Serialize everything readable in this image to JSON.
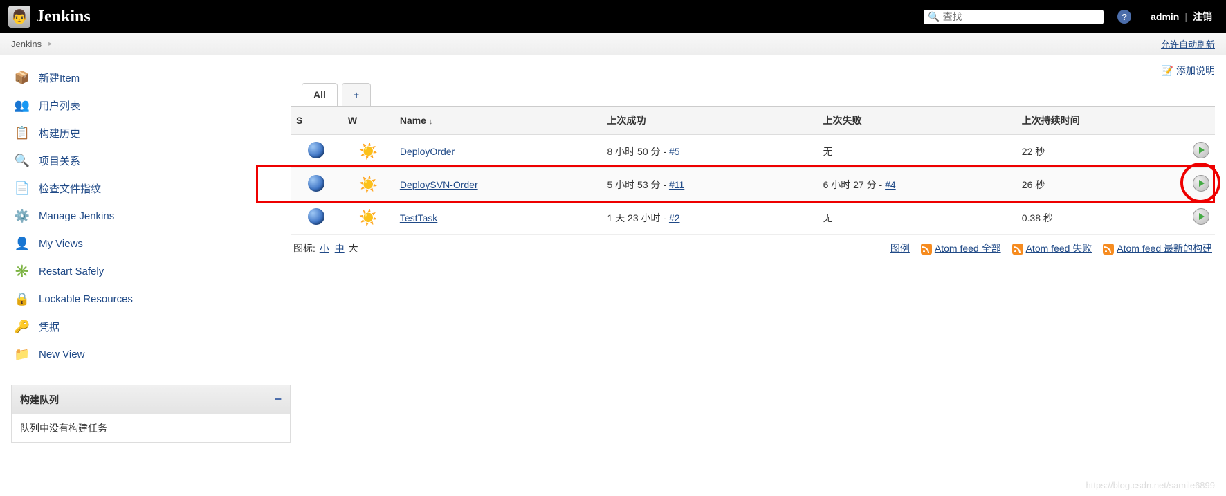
{
  "header": {
    "logo_text": "Jenkins",
    "search_placeholder": "查找",
    "user": "admin",
    "logout": "注销"
  },
  "breadcrumb": {
    "root": "Jenkins",
    "auto_refresh": "允许自动刷新"
  },
  "sidebar": {
    "items": [
      {
        "label": "新建Item",
        "icon": "📦"
      },
      {
        "label": "用户列表",
        "icon": "👥"
      },
      {
        "label": "构建历史",
        "icon": "📋"
      },
      {
        "label": "项目关系",
        "icon": "🔍"
      },
      {
        "label": "检查文件指纹",
        "icon": "📄"
      },
      {
        "label": "Manage Jenkins",
        "icon": "⚙️"
      },
      {
        "label": "My Views",
        "icon": "👤"
      },
      {
        "label": "Restart Safely",
        "icon": "✳️"
      },
      {
        "label": "Lockable Resources",
        "icon": "🔒"
      },
      {
        "label": "凭据",
        "icon": "🔑"
      },
      {
        "label": "New View",
        "icon": "📁"
      }
    ],
    "panel_title": "构建队列",
    "panel_body": "队列中没有构建任务"
  },
  "content": {
    "add_description": "添加说明",
    "tabs": {
      "all": "All",
      "add": "+"
    },
    "columns": {
      "s": "S",
      "w": "W",
      "name": "Name",
      "last_success": "上次成功",
      "last_failure": "上次失败",
      "duration": "上次持续时间"
    },
    "jobs": [
      {
        "name": "DeployOrder",
        "success_time": "8 小时 50 分",
        "success_build": "#5",
        "failure": "无",
        "duration": "22 秒"
      },
      {
        "name": "DeploySVN-Order",
        "success_time": "5 小时 53 分",
        "success_build": "#11",
        "failure_time": "6 小时 27 分",
        "failure_build": "#4",
        "duration": "26 秒"
      },
      {
        "name": "TestTask",
        "success_time": "1 天 23 小时",
        "success_build": "#2",
        "failure": "无",
        "duration": "0.38 秒"
      }
    ],
    "icon_size_label": "图标:",
    "icon_sizes": {
      "small": "小",
      "medium": "中",
      "large": "大"
    },
    "legend": "图例",
    "feeds": {
      "all": "Atom feed 全部",
      "failed": "Atom feed 失败",
      "latest": "Atom feed 最新的构建"
    }
  },
  "watermark": "https://blog.csdn.net/samile6899"
}
